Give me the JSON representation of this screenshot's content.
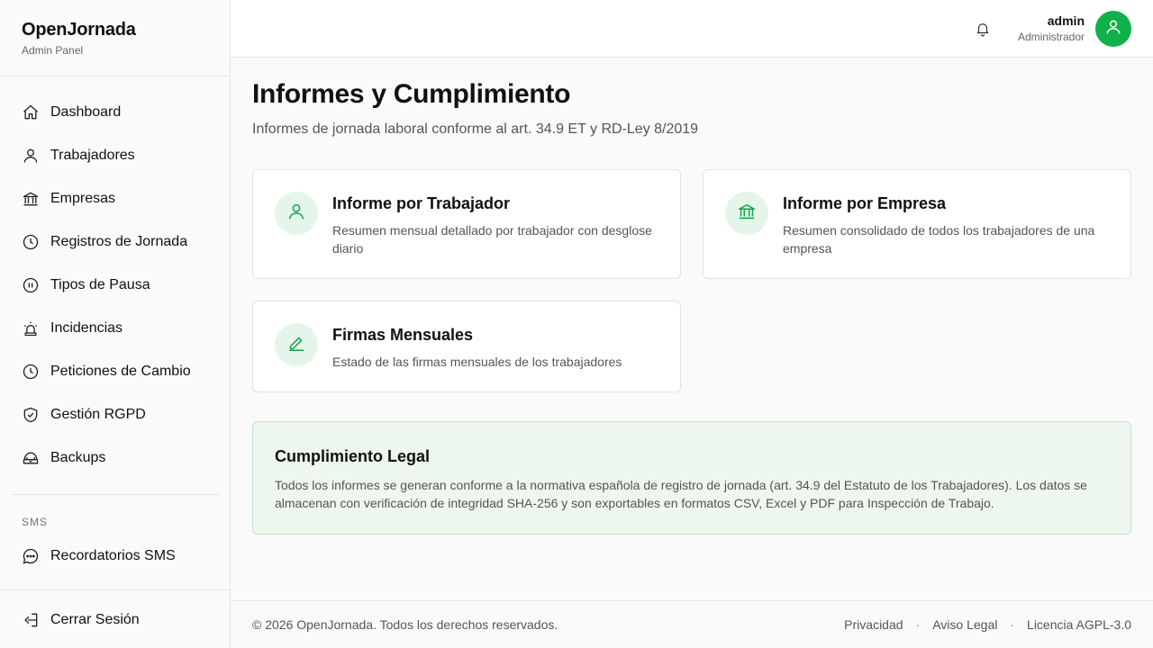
{
  "brand": {
    "title": "OpenJornada",
    "subtitle": "Admin Panel"
  },
  "nav": {
    "items": [
      {
        "label": "Dashboard",
        "icon": "home-icon"
      },
      {
        "label": "Trabajadores",
        "icon": "user-icon"
      },
      {
        "label": "Empresas",
        "icon": "bank-icon"
      },
      {
        "label": "Registros de Jornada",
        "icon": "clock-icon"
      },
      {
        "label": "Tipos de Pausa",
        "icon": "pause-icon"
      },
      {
        "label": "Incidencias",
        "icon": "alarm-icon"
      },
      {
        "label": "Peticiones de Cambio",
        "icon": "clock-icon"
      },
      {
        "label": "Gestión RGPD",
        "icon": "shield-check-icon"
      },
      {
        "label": "Backups",
        "icon": "database-icon"
      }
    ],
    "section_label": "SMS",
    "sms_item": {
      "label": "Recordatorios SMS",
      "icon": "chat-bubble-icon"
    },
    "logout": {
      "label": "Cerrar Sesión",
      "icon": "logout-icon"
    }
  },
  "topbar": {
    "notifications_icon": "bell-icon",
    "user_name": "admin",
    "user_role": "Administrador",
    "avatar_icon": "user-icon",
    "accent_color": "#10b04a"
  },
  "page": {
    "title": "Informes y Cumplimiento",
    "subtitle": "Informes de jornada laboral conforme al art. 34.9 ET y RD-Ley 8/2019"
  },
  "cards": [
    {
      "title": "Informe por Trabajador",
      "description": "Resumen mensual detallado por trabajador con desglose diario",
      "icon": "user-icon"
    },
    {
      "title": "Informe por Empresa",
      "description": "Resumen consolidado de todos los trabajadores de una empresa",
      "icon": "bank-icon"
    },
    {
      "title": "Firmas Mensuales",
      "description": "Estado de las firmas mensuales de los trabajadores",
      "icon": "signature-pen-icon"
    }
  ],
  "legal": {
    "title": "Cumplimiento Legal",
    "text": "Todos los informes se generan conforme a la normativa española de registro de jornada (art. 34.9 del Estatuto de los Trabajadores). Los datos se almacenan con verificación de integridad SHA-256 y son exportables en formatos CSV, Excel y PDF para Inspección de Trabajo."
  },
  "footer": {
    "copyright": "© 2026 OpenJornada. Todos los derechos reservados.",
    "links": [
      "Privacidad",
      "Aviso Legal",
      "Licencia AGPL-3.0"
    ],
    "separator": "·"
  }
}
